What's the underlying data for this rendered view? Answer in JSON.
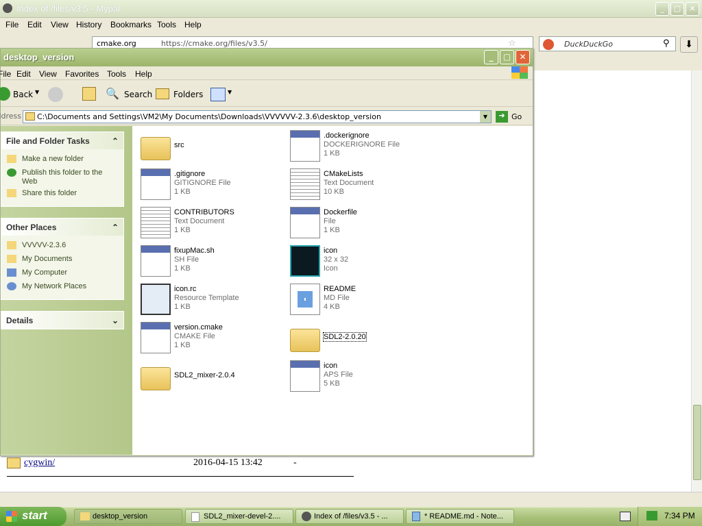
{
  "browser": {
    "title": "Index of /files/v3.5 - Mypal",
    "menu": [
      "File",
      "Edit",
      "View",
      "History",
      "Bookmarks",
      "Tools",
      "Help"
    ],
    "url_site": "cmake.org",
    "url": "https://cmake.org/files/v3.5/",
    "search_placeholder": "DuckDuckGo",
    "listing_row": {
      "name": "cygwin/",
      "date": "2016-04-15 13:42",
      "size": "-"
    }
  },
  "explorer": {
    "title": "desktop_version",
    "menu": [
      "File",
      "Edit",
      "View",
      "Favorites",
      "Tools",
      "Help"
    ],
    "toolbar": {
      "back": "Back",
      "search": "Search",
      "folders": "Folders"
    },
    "address_label": "Address",
    "address": "C:\\Documents and Settings\\VM2\\My Documents\\Downloads\\VVVVVV-2.3.6\\desktop_version",
    "go": "Go",
    "tasks_panel": {
      "title": "File and Folder Tasks",
      "links": [
        "Make a new folder",
        "Publish this folder to the Web",
        "Share this folder"
      ]
    },
    "places_panel": {
      "title": "Other Places",
      "links": [
        "VVVVV-2.3.6",
        "My Documents",
        "My Computer",
        "My Network Places"
      ]
    },
    "details_panel": {
      "title": "Details"
    },
    "files": [
      {
        "name": "src",
        "type": "",
        "size": "",
        "icon": "folder"
      },
      {
        "name": ".dockerignore",
        "type": "DOCKERIGNORE File",
        "size": "1 KB",
        "icon": "app-file"
      },
      {
        "name": ".gitignore",
        "type": "GITIGNORE File",
        "size": "1 KB",
        "icon": "app-file"
      },
      {
        "name": "CMakeLists",
        "type": "Text Document",
        "size": "10 KB",
        "icon": "text-doc"
      },
      {
        "name": "CONTRIBUTORS",
        "type": "Text Document",
        "size": "1 KB",
        "icon": "text-doc"
      },
      {
        "name": "Dockerfile",
        "type": "File",
        "size": "1 KB",
        "icon": "app-file"
      },
      {
        "name": "fixupMac.sh",
        "type": "SH File",
        "size": "1 KB",
        "icon": "app-file"
      },
      {
        "name": "icon",
        "type": "32 x 32",
        "size": "Icon",
        "icon": "game-icon"
      },
      {
        "name": "icon.rc",
        "type": "Resource Template",
        "size": "1 KB",
        "icon": "resource"
      },
      {
        "name": "README",
        "type": "MD File",
        "size": "4 KB",
        "icon": "md-file"
      },
      {
        "name": "version.cmake",
        "type": "CMAKE File",
        "size": "1 KB",
        "icon": "app-file"
      },
      {
        "name": "SDL2-2.0.20",
        "type": "",
        "size": "",
        "icon": "folder"
      },
      {
        "name": "SDL2_mixer-2.0.4",
        "type": "",
        "size": "",
        "icon": "folder"
      },
      {
        "name": "icon",
        "type": "APS File",
        "size": "5 KB",
        "icon": "app-file"
      }
    ]
  },
  "taskbar": {
    "start": "start",
    "tasks": [
      "desktop_version",
      "SDL2_mixer-devel-2....",
      "Index of /files/v3.5 - ...",
      "* README.md - Note..."
    ],
    "clock": "7:34 PM"
  },
  "colors": {
    "xp_olive_title": "#9db56c",
    "taskbar": "#a9c27b",
    "start": "#4d9a2f",
    "close": "#e0663a"
  }
}
